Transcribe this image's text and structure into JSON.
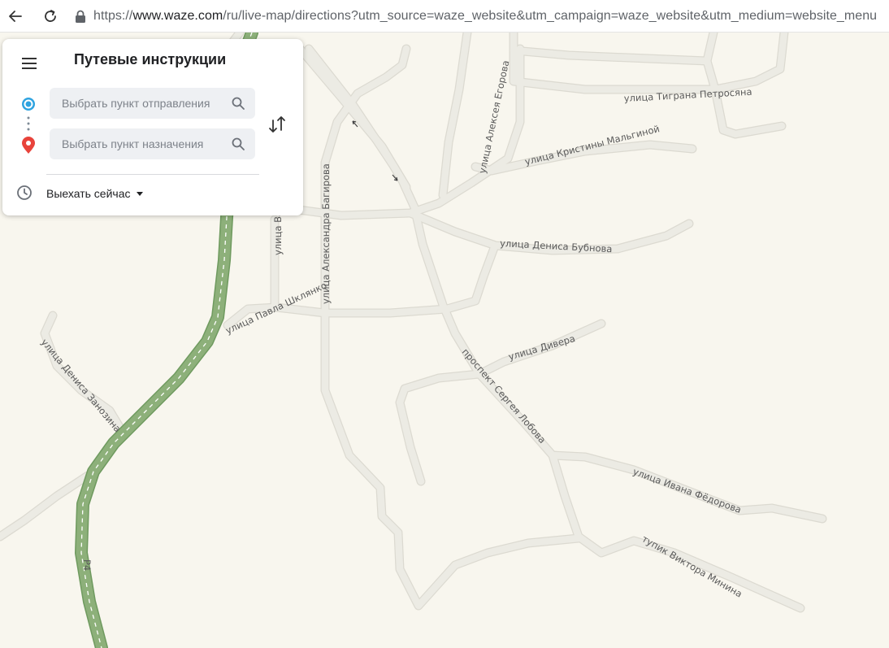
{
  "browser": {
    "url_host": "www.waze.com",
    "url_prefix": "https://",
    "url_rest": "/ru/live-map/directions?utm_source=waze_website&utm_campaign=waze_website&utm_medium=website_menu"
  },
  "panel": {
    "title": "Путевые инструкции",
    "origin_placeholder": "Выбрать пункт отправления",
    "destination_placeholder": "Выбрать пункт назначения",
    "depart_label": "Выехать сейчас"
  },
  "map": {
    "highway_label": "Р4",
    "streets": {
      "tigran": "улица Тиграна Петросяна",
      "egorova": "улица Алексея Егорова",
      "malginoy": "улица Кристины Мальгиной",
      "bubnova": "улица Дениса Бубнова",
      "bagirova": "улица Александра Багирова",
      "va": "улица Ва",
      "shklyanko": "улица Павла Шклянко",
      "zanozina": "улица Дениса Занозина",
      "divera": "улица Дивера",
      "lobova": "проспект Сергея Лобова",
      "fedorova": "улица Ивана Фёдорова",
      "minina": "тупик Виктора Минина"
    }
  },
  "colors": {
    "map_bg": "#f8f6ee",
    "road_fill": "#ecebe4",
    "road_edge": "#dcdad1",
    "highway": "#8db07a",
    "origin": "#2ea3e0",
    "destination": "#e8433b"
  }
}
